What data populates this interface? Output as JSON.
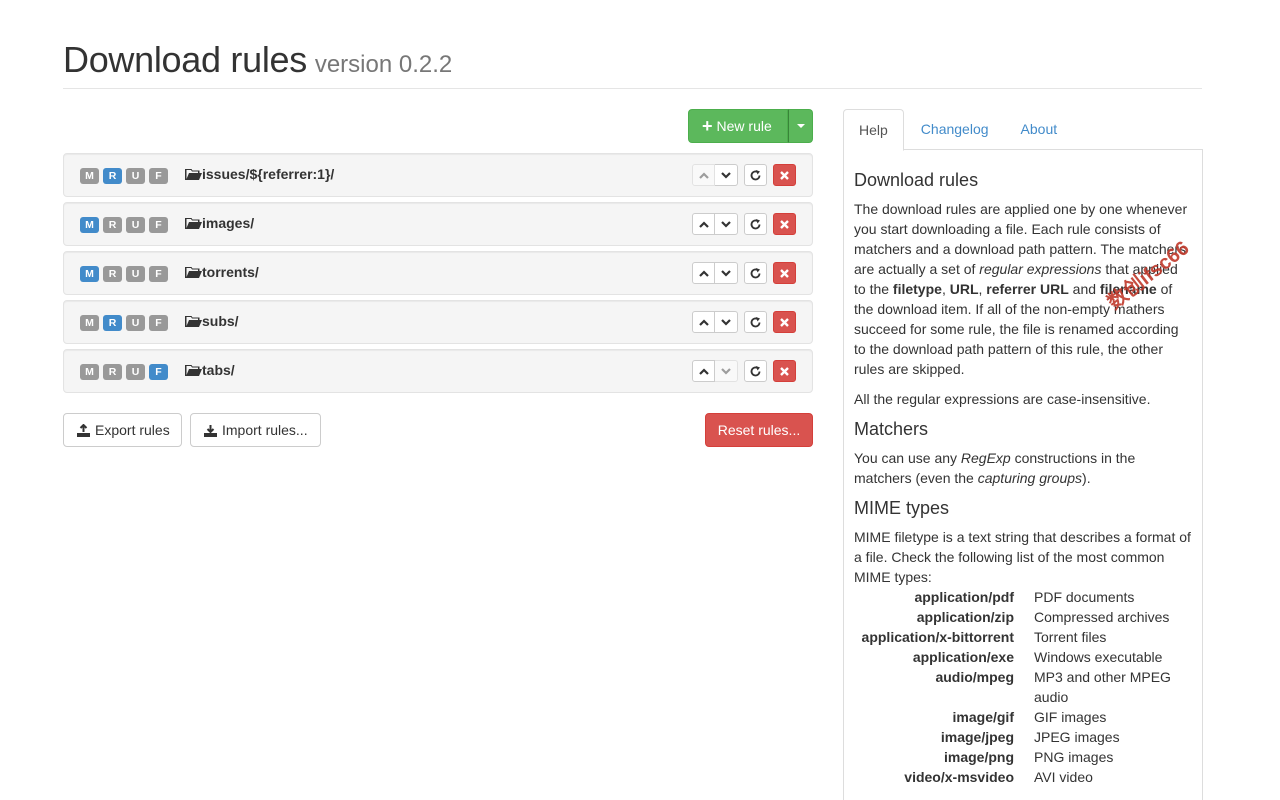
{
  "page": {
    "title": "Download rules",
    "version": "version 0.2.2"
  },
  "toolbar": {
    "new_rule_label": "New rule",
    "export_label": "Export rules",
    "import_label": "Import rules...",
    "reset_label": "Reset rules..."
  },
  "rule_flags": [
    "M",
    "R",
    "U",
    "F"
  ],
  "rules": [
    {
      "path": "issues/${referrer:1}/",
      "active_flags": [
        "R"
      ],
      "up_enabled": false,
      "down_enabled": true
    },
    {
      "path": "images/",
      "active_flags": [
        "M"
      ],
      "up_enabled": true,
      "down_enabled": true
    },
    {
      "path": "torrents/",
      "active_flags": [
        "M"
      ],
      "up_enabled": true,
      "down_enabled": true
    },
    {
      "path": "subs/",
      "active_flags": [
        "R"
      ],
      "up_enabled": true,
      "down_enabled": true
    },
    {
      "path": "tabs/",
      "active_flags": [
        "F"
      ],
      "up_enabled": true,
      "down_enabled": false
    }
  ],
  "colors": {
    "success": "#5cb85c",
    "danger": "#d9534f",
    "primary": "#428bca",
    "label_default": "#999999"
  },
  "tabs": [
    {
      "label": "Help",
      "active": true
    },
    {
      "label": "Changelog",
      "active": false
    },
    {
      "label": "About",
      "active": false
    }
  ],
  "help": {
    "heading": "Download rules",
    "intro": [
      {
        "t": "The download rules are applied one by one whenever you start downloading a file. Each rule consists of matchers and a download path pattern. The matchers are actually a set of "
      },
      {
        "t": "regular expressions",
        "s": "em"
      },
      {
        "t": " that applied to the "
      },
      {
        "t": "filetype",
        "s": "b"
      },
      {
        "t": ", "
      },
      {
        "t": "URL",
        "s": "b"
      },
      {
        "t": ", "
      },
      {
        "t": "referrer URL",
        "s": "b"
      },
      {
        "t": " and "
      },
      {
        "t": "filename",
        "s": "b"
      },
      {
        "t": " of the download item. If all of the non-empty mathers succeed for some rule, the file is renamed according to the download path pattern of this rule, the other rules are skipped."
      }
    ],
    "case_note": "All the regular expressions are case-insensitive.",
    "matchers_heading": "Matchers",
    "matchers_text": [
      {
        "t": "You can use any "
      },
      {
        "t": "RegExp",
        "s": "em"
      },
      {
        "t": " constructions in the matchers (even the "
      },
      {
        "t": "capturing groups",
        "s": "em"
      },
      {
        "t": ")."
      }
    ],
    "mime_heading": "MIME types",
    "mime_intro": "MIME filetype is a text string that describes a format of a file. Check the following list of the most common MIME types:",
    "mime_types": [
      {
        "type": "application/pdf",
        "desc": "PDF documents"
      },
      {
        "type": "application/zip",
        "desc": "Compressed archives"
      },
      {
        "type": "application/x-bittorrent",
        "desc": "Torrent files"
      },
      {
        "type": "application/exe",
        "desc": "Windows executable"
      },
      {
        "type": "audio/mpeg",
        "desc": "MP3 and other MPEG audio"
      },
      {
        "type": "image/gif",
        "desc": "GIF images"
      },
      {
        "type": "image/jpeg",
        "desc": "JPEG images"
      },
      {
        "type": "image/png",
        "desc": "PNG images"
      },
      {
        "type": "video/x-msvideo",
        "desc": "AVI video"
      }
    ]
  },
  "watermark": "数创ifsc66"
}
